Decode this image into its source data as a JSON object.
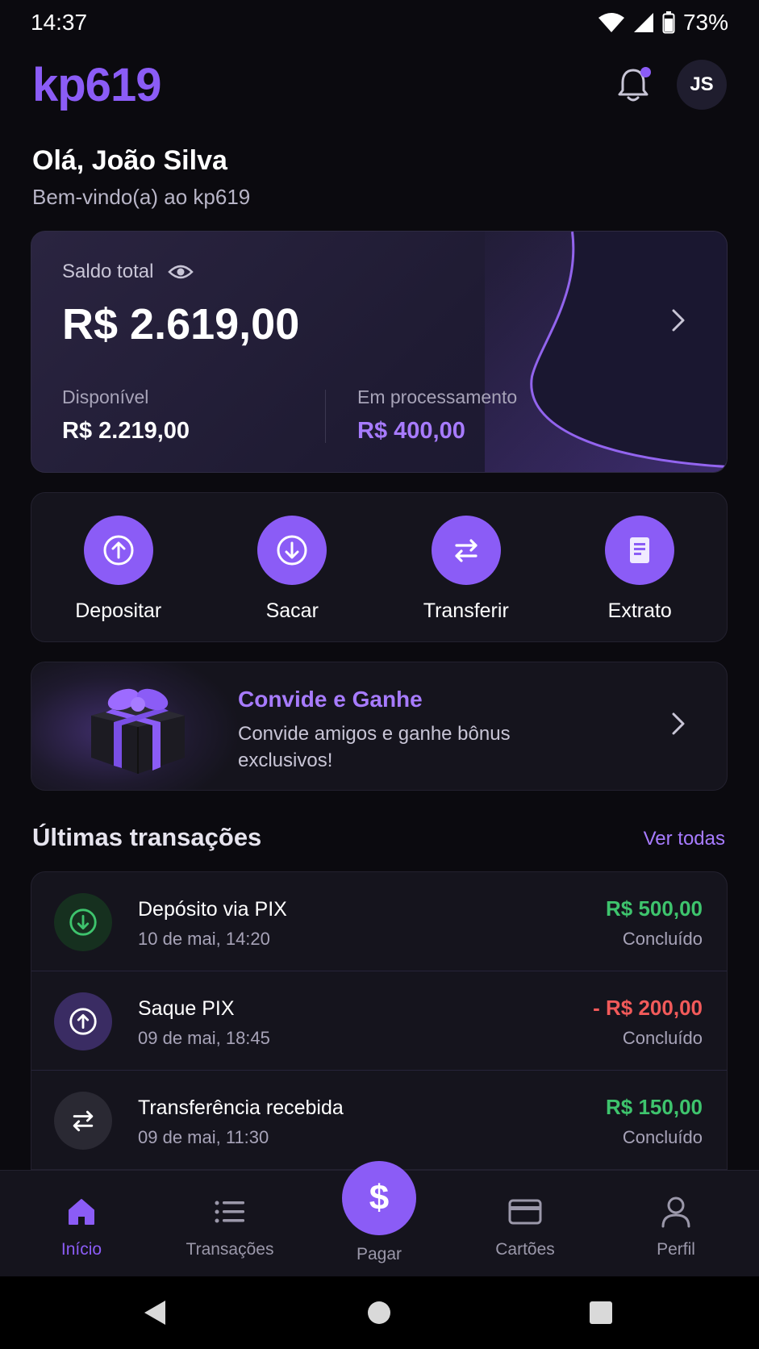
{
  "status_bar": {
    "time": "14:37",
    "battery": "73%"
  },
  "header": {
    "logo": "kp619",
    "avatar_initials": "JS"
  },
  "greeting": {
    "title": "Olá, João Silva",
    "subtitle": "Bem-vindo(a) ao kp619"
  },
  "balance": {
    "label": "Saldo total",
    "total": "R$ 2.619,00",
    "available_label": "Disponível",
    "available_value": "R$ 2.219,00",
    "processing_label": "Em processamento",
    "processing_value": "R$ 400,00"
  },
  "actions": [
    {
      "label": "Depositar",
      "icon": "arrow-up-circle-icon"
    },
    {
      "label": "Sacar",
      "icon": "arrow-down-circle-icon"
    },
    {
      "label": "Transferir",
      "icon": "transfer-icon"
    },
    {
      "label": "Extrato",
      "icon": "receipt-icon"
    }
  ],
  "invite": {
    "title": "Convide e Ganhe",
    "text": "Convide amigos e ganhe bônus exclusivos!"
  },
  "transactions_section": {
    "title": "Últimas transações",
    "see_all": "Ver todas"
  },
  "transactions": [
    {
      "name": "Depósito via PIX",
      "date": "10 de mai, 14:20",
      "amount": "R$ 500,00",
      "status": "Concluído"
    },
    {
      "name": "Saque PIX",
      "date": "09 de mai, 18:45",
      "amount": "- R$ 200,00",
      "status": "Concluído"
    },
    {
      "name": "Transferência recebida",
      "date": "09 de mai, 11:30",
      "amount": "R$ 150,00",
      "status": "Concluído"
    }
  ],
  "bottom_nav": {
    "home": "Início",
    "transactions": "Transações",
    "pay": "Pagar",
    "pay_symbol": "$",
    "cards": "Cartões",
    "profile": "Perfil"
  },
  "colors": {
    "accent": "#8b5cf6",
    "positive": "#3ec46d",
    "negative": "#f25a5a",
    "background": "#0b0a0f"
  }
}
